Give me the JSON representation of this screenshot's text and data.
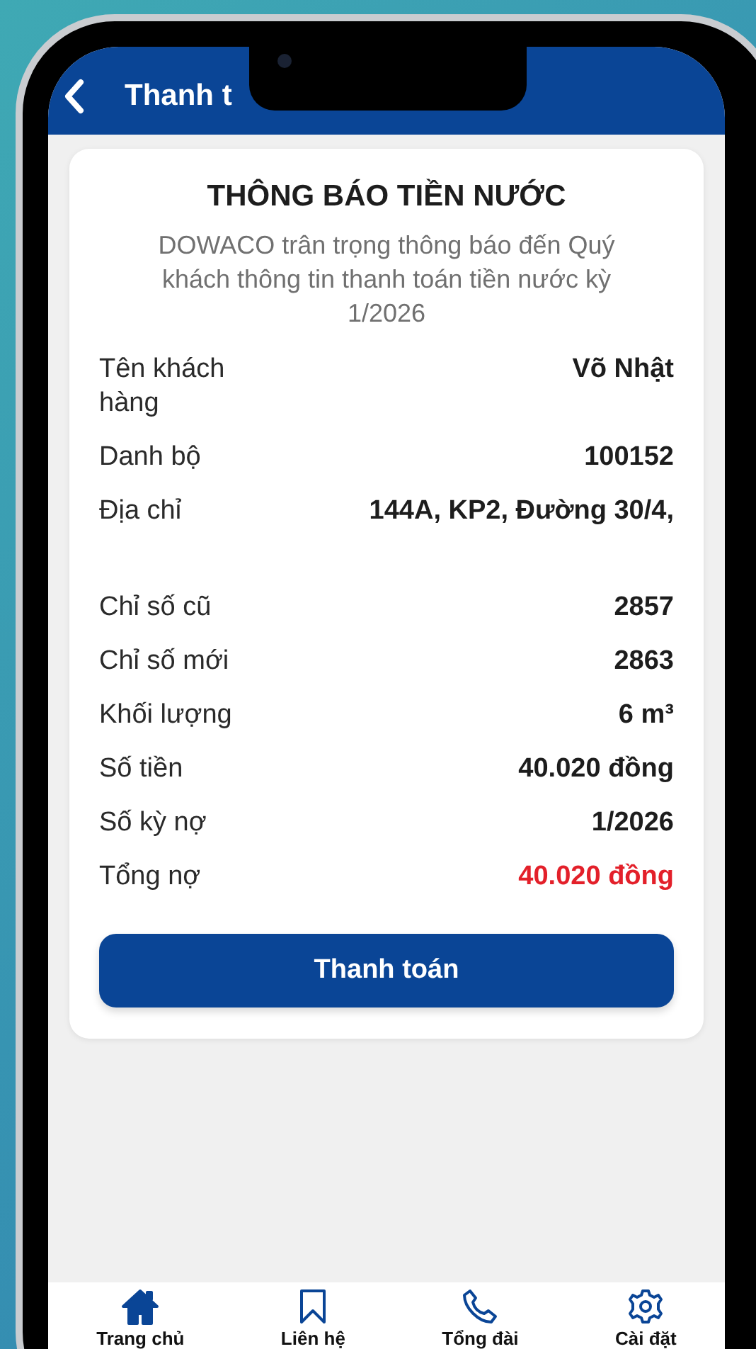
{
  "header": {
    "title": "Thanh t"
  },
  "notice": {
    "title": "THÔNG BÁO TIỀN NƯỚC",
    "message": "DOWACO trân trọng thông báo đến Quý khách thông tin thanh toán tiền nước kỳ 1/2026",
    "rows": [
      {
        "label": "Tên khách hàng",
        "value": "Võ Nhật",
        "kind": "plain"
      },
      {
        "label": "Danh bộ",
        "value": "100152",
        "kind": "plain"
      },
      {
        "label": "Địa chỉ",
        "value": "144A, KP2, Đường 30/4,",
        "kind": "plain"
      },
      {
        "kind": "gap"
      },
      {
        "label": "Chỉ số cũ",
        "value": "2857",
        "kind": "plain"
      },
      {
        "label": "Chỉ số mới",
        "value": "2863",
        "kind": "plain"
      },
      {
        "label": "Khối lượng",
        "value": "6 m³",
        "kind": "plain"
      },
      {
        "label": "Số tiền",
        "value": "40.020 đồng",
        "kind": "plain"
      },
      {
        "label": "Số kỳ nợ",
        "value": "1/2026",
        "kind": "plain"
      },
      {
        "label": "Tổng nợ",
        "value": "40.020 đồng",
        "kind": "alert"
      }
    ],
    "pay_button": "Thanh toán"
  },
  "nav": [
    {
      "label": "Trang chủ",
      "selected": true
    },
    {
      "label": "Liên hệ",
      "selected": false
    },
    {
      "label": "Tổng đài",
      "selected": false
    },
    {
      "label": "Cài đặt",
      "selected": false
    }
  ]
}
